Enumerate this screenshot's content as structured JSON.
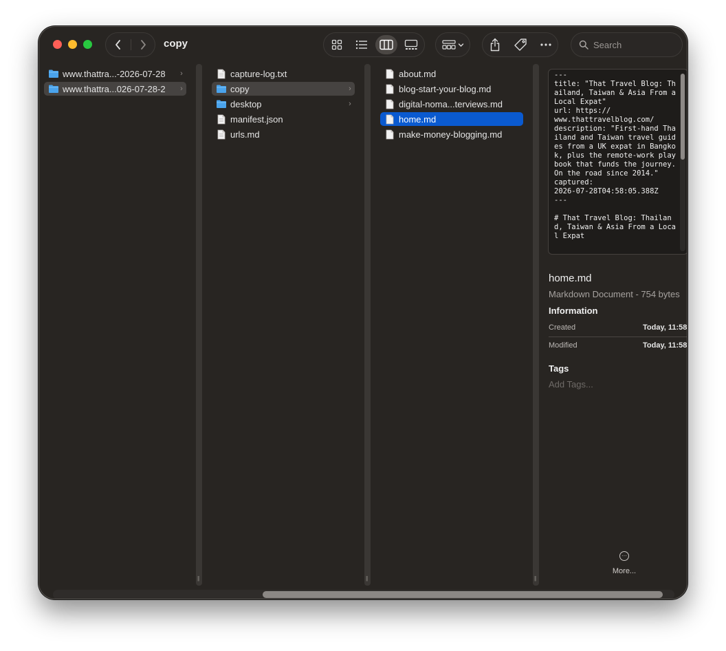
{
  "window": {
    "title": "copy"
  },
  "toolbar": {
    "search_placeholder": "Search"
  },
  "column1": {
    "items": [
      {
        "label": "www.thattra...-2026-07-28",
        "icon": "folder-icon",
        "chevron": "›",
        "selected": false
      },
      {
        "label": "www.thattra...026-07-28-2",
        "icon": "folder-icon",
        "chevron": "›",
        "selected": true
      }
    ]
  },
  "column2": {
    "items": [
      {
        "label": "capture-log.txt",
        "icon": "document-icon",
        "chevron": ""
      },
      {
        "label": "copy",
        "icon": "folder-icon",
        "chevron": "›",
        "selected": true
      },
      {
        "label": "desktop",
        "icon": "folder-icon",
        "chevron": "›"
      },
      {
        "label": "manifest.json",
        "icon": "document-icon",
        "chevron": ""
      },
      {
        "label": "urls.md",
        "icon": "document-icon",
        "chevron": ""
      }
    ]
  },
  "column3": {
    "items": [
      {
        "label": "about.md",
        "icon": "document-icon"
      },
      {
        "label": "blog-start-your-blog.md",
        "icon": "document-icon"
      },
      {
        "label": "digital-noma...terviews.md",
        "icon": "document-icon"
      },
      {
        "label": "home.md",
        "icon": "document-icon",
        "selected": true
      },
      {
        "label": "make-money-blogging.md",
        "icon": "document-icon"
      }
    ]
  },
  "preview": {
    "text": "---\ntitle: \"That Travel Blog: Thailand, Taiwan & Asia From a Local Expat\"\nurl: https://\nwww.thattravelblog.com/\ndescription: \"First-hand Thailand and Taiwan travel guides from a UK expat in Bangkok, plus the remote-work playbook that funds the journey. On the road since 2014.\"\ncaptured:\n2026-07-28T04:58:05.388Z\n---\n\n# That Travel Blog: Thailand, Taiwan & Asia From a Local Expat",
    "scroll_fraction": 0.48
  },
  "info": {
    "name": "home.md",
    "kind": "Markdown Document - 754 bytes",
    "section_title": "Information",
    "created_label": "Created",
    "created_value": "Today, 11:58",
    "modified_label": "Modified",
    "modified_value": "Today, 11:58",
    "tags_title": "Tags",
    "tags_placeholder": "Add Tags...",
    "more_label": "More..."
  },
  "colors": {
    "window_bg": "#282522",
    "selection_blue": "#0a5ad0",
    "selection_gray": "#464341",
    "folder_blue": "#4aa3ec"
  }
}
